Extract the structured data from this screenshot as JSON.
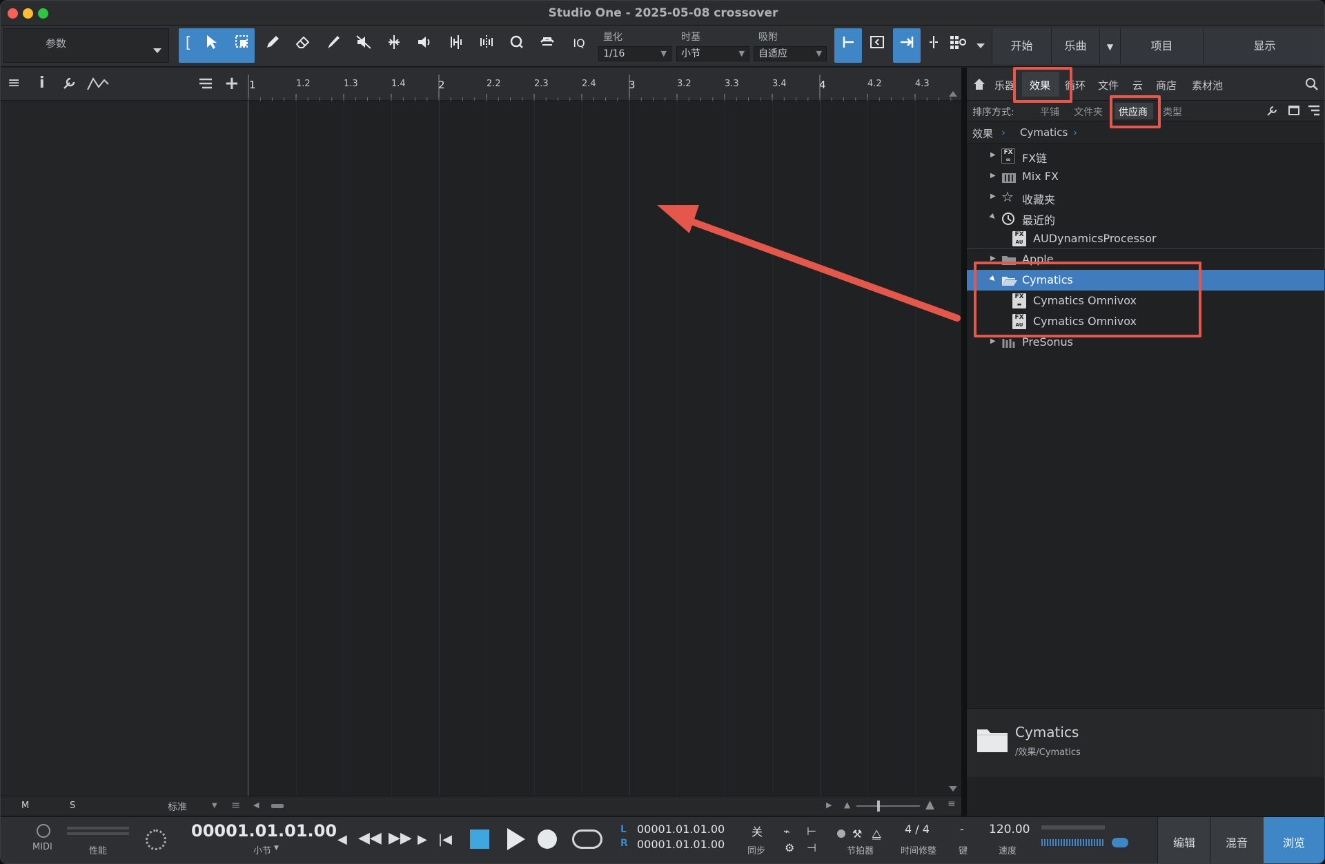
{
  "window": {
    "title": "Studio One - 2025-05-08 crossover"
  },
  "toolbar": {
    "param_label": "参数",
    "quantize_label": "量化",
    "quantize_value": "1/16",
    "timebase_label": "时基",
    "timebase_value": "小节",
    "snap_label": "吸附",
    "snap_value": "自适应",
    "iq_label": "IQ",
    "right_buttons": [
      "开始",
      "乐曲",
      "项目",
      "显示"
    ]
  },
  "ruler": {
    "labels": [
      "1",
      "1.2",
      "1.3",
      "1.4",
      "2",
      "2.2",
      "2.3",
      "2.4",
      "3",
      "3.2",
      "3.3",
      "3.4",
      "4",
      "4.2",
      "4.3"
    ]
  },
  "browser": {
    "tabs": [
      "乐器",
      "效果",
      "循环",
      "文件",
      "云",
      "商店",
      "素材池"
    ],
    "active_tab": "效果",
    "sort_label": "排序方式:",
    "sort_options": [
      "平铺",
      "文件夹",
      "供应商",
      "类型"
    ],
    "active_sort": "供应商",
    "breadcrumb": [
      "效果",
      "Cymatics"
    ],
    "tree": [
      {
        "label": "FX链"
      },
      {
        "label": "Mix FX"
      },
      {
        "label": "收藏夹"
      },
      {
        "label": "最近的"
      },
      {
        "label": "AUDynamicsProcessor"
      },
      {
        "label": "Apple"
      },
      {
        "label": "Cymatics"
      },
      {
        "label": "Cymatics Omnivox"
      },
      {
        "label": "Cymatics Omnivox"
      },
      {
        "label": "PreSonus"
      }
    ],
    "info_title": "Cymatics",
    "info_path": "/效果/Cymatics"
  },
  "bottom_left": {
    "m_label": "M",
    "s_label": "S",
    "mode": "标准"
  },
  "transport": {
    "midi": "MIDI",
    "performance": "性能",
    "position": "00001.01.01.00",
    "position_unit": "小节",
    "loop_l": "00001.01.01.00",
    "loop_r": "00001.01.01.00",
    "l_mark": "L",
    "r_mark": "R",
    "sync_value": "关",
    "sync_label": "同步",
    "metronome_label": "节拍器",
    "signature": "4 / 4",
    "signature_label": "时间修整",
    "key_value": "-",
    "key_label": "键",
    "tempo": "120.00",
    "tempo_label": "速度",
    "view_buttons": [
      "编辑",
      "混音",
      "浏览"
    ]
  }
}
